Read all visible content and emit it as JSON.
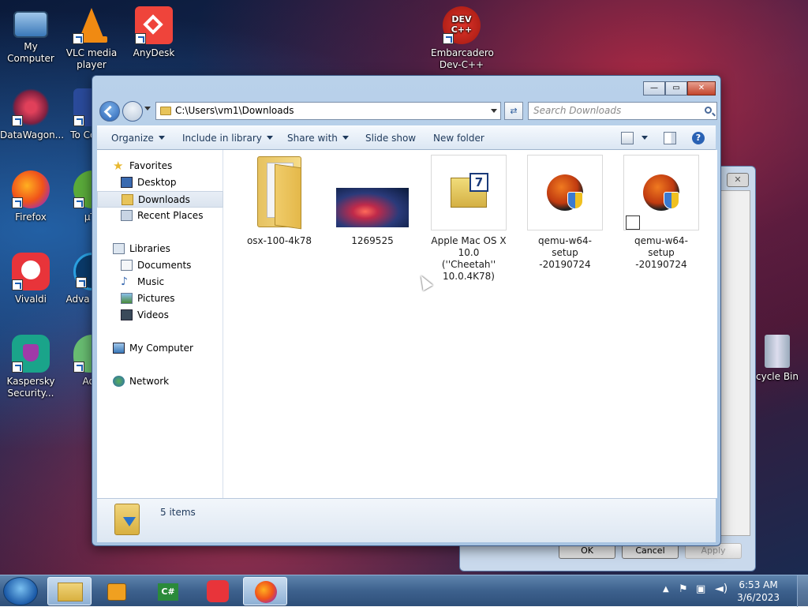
{
  "desktop": {
    "icons": [
      {
        "label": "My Computer"
      },
      {
        "label": "VLC media player"
      },
      {
        "label": "AnyDesk"
      },
      {
        "label": "Embarcadero Dev-C++"
      },
      {
        "label": "DataWagon..."
      },
      {
        "label": "To Comm"
      },
      {
        "label": "Firefox"
      },
      {
        "label": "µTo"
      },
      {
        "label": "Vivaldi"
      },
      {
        "label": "Adva Syste"
      },
      {
        "label": "Kaspersky Security..."
      },
      {
        "label": "AdG"
      },
      {
        "label": "cycle Bin"
      }
    ],
    "devcpp_logo_text": "DEV C++"
  },
  "background_dialog": {
    "ok_label": "OK",
    "cancel_label": "Cancel",
    "apply_label": "Apply"
  },
  "explorer": {
    "address": "C:\\Users\\vm1\\Downloads",
    "search_placeholder": "Search Downloads",
    "toolbar": {
      "organize": "Organize",
      "include_in_library": "Include in library",
      "share_with": "Share with",
      "slide_show": "Slide show",
      "new_folder": "New folder"
    },
    "nav": {
      "favorites": "Favorites",
      "desktop": "Desktop",
      "downloads": "Downloads",
      "recent_places": "Recent Places",
      "libraries": "Libraries",
      "documents": "Documents",
      "music": "Music",
      "pictures": "Pictures",
      "videos": "Videos",
      "my_computer": "My Computer",
      "network": "Network"
    },
    "files": [
      {
        "name": "osx-100-4k78",
        "icon": "folder-icon"
      },
      {
        "name": "1269525",
        "icon": "image-thumbnail"
      },
      {
        "name": "Apple Mac OS X 10.0 (''Cheetah'' 10.0.4K78)",
        "icon": "7zip-archive-icon"
      },
      {
        "name": "qemu-w64-setup -20190724",
        "icon": "qemu-installer-icon"
      },
      {
        "name": "qemu-w64-setup -20190724",
        "icon": "qemu-installer-shortcut-icon"
      }
    ],
    "status": "5 items"
  },
  "taskbar": {
    "time": "6:53 AM",
    "date": "3/6/2023",
    "c_sharp_label": "C#"
  },
  "colors": {
    "accent": "#2a62b4",
    "folder": "#e8c45a"
  }
}
